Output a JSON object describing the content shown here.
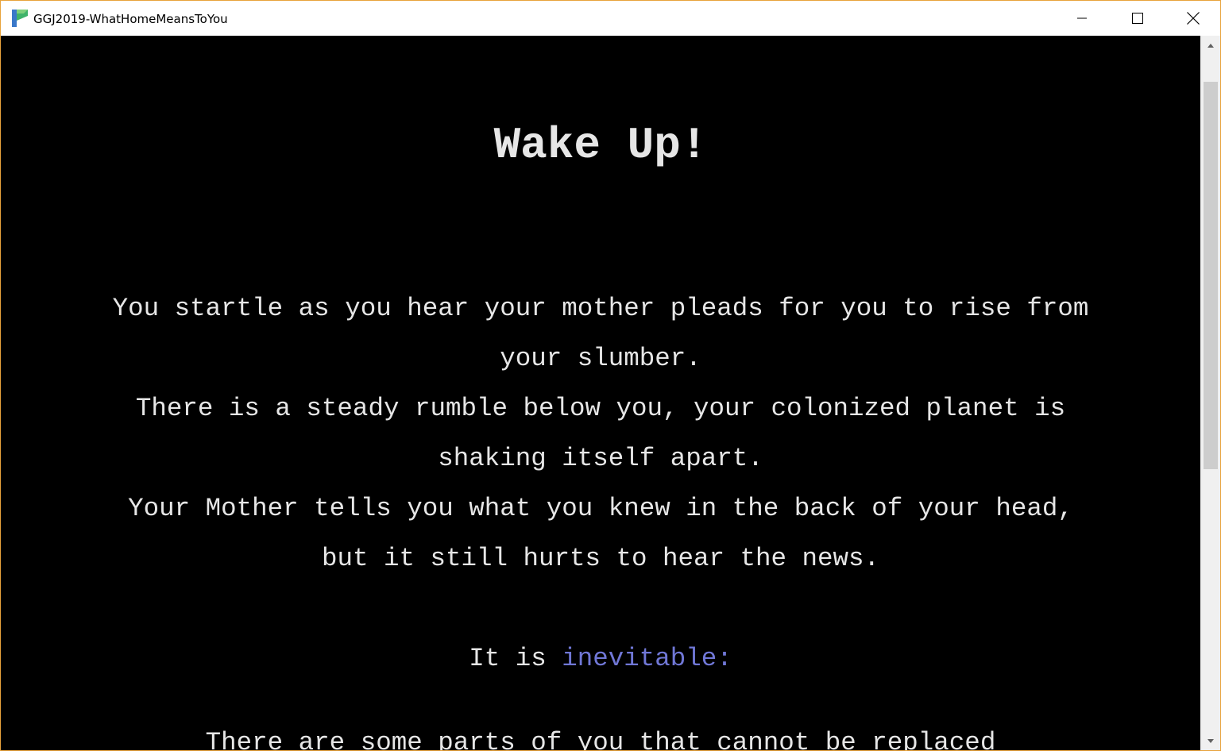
{
  "window": {
    "title": "GGJ2019-WhatHomeMeansToYou",
    "icon": "app-icon"
  },
  "controls": {
    "minimize_icon": "minimize-icon",
    "maximize_icon": "maximize-icon",
    "close_icon": "close-icon"
  },
  "story": {
    "heading": "Wake Up!",
    "line1": "You startle as you hear your mother pleads for you to rise from your slumber.",
    "line2": "There is a steady rumble below you, your colonized planet is shaking itself apart.",
    "line3": "Your Mother tells you what you knew in the back of your head, but it still hurts to hear the news.",
    "choice_prefix": "It is ",
    "choice_link": "inevitable:",
    "cut_line": "There are some parts of you that cannot be replaced"
  },
  "colors": {
    "background": "#000000",
    "text": "#e6e6e6",
    "link": "#7077d6",
    "window_border": "#e8a33c"
  }
}
